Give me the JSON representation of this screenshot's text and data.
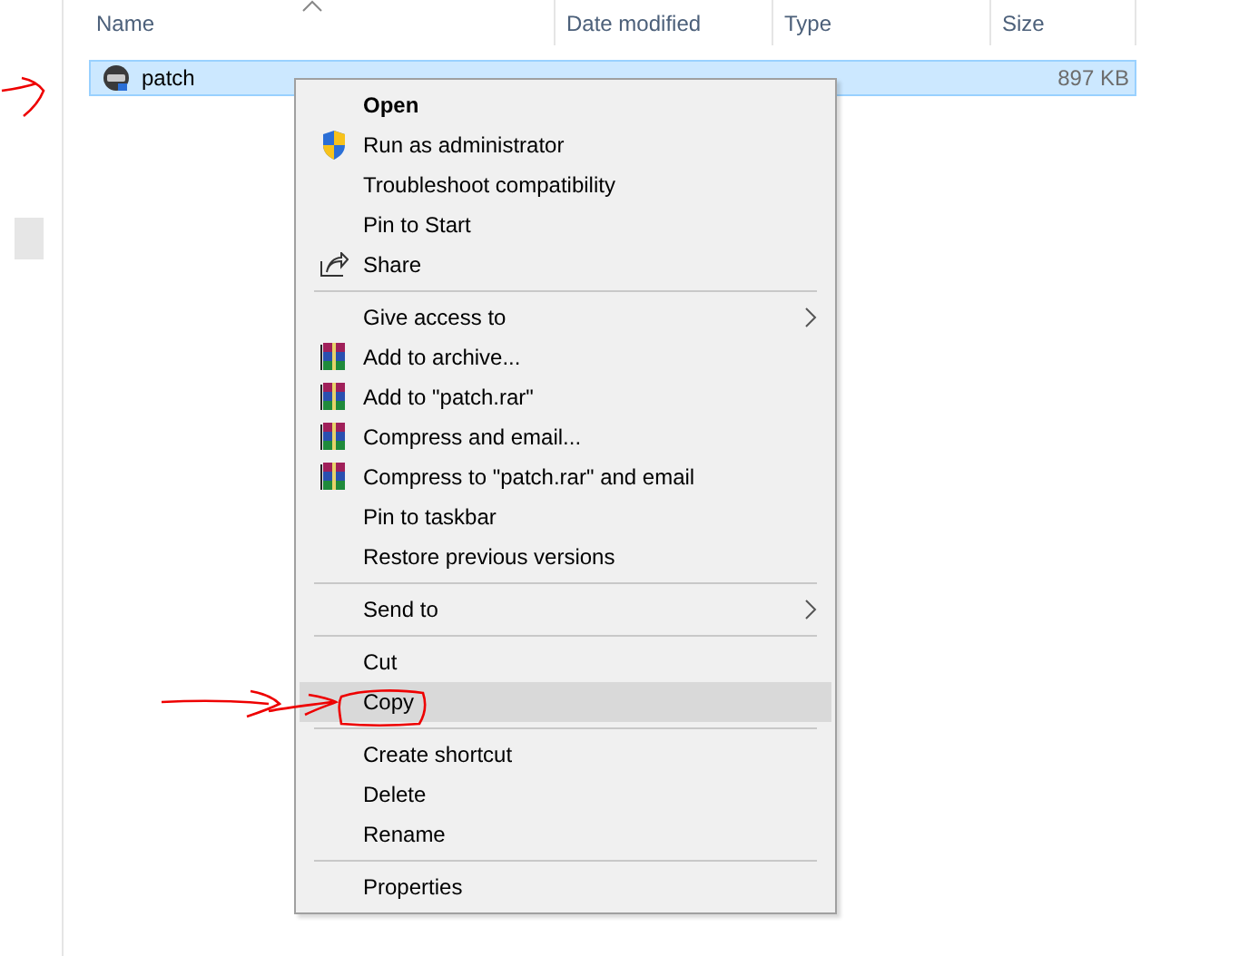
{
  "columns": [
    {
      "label": "Name",
      "sorted": true
    },
    {
      "label": "Date modified",
      "sorted": false
    },
    {
      "label": "Type",
      "sorted": false
    },
    {
      "label": "Size",
      "sorted": false
    }
  ],
  "file": {
    "name": "patch",
    "size": "897 KB",
    "selected": true
  },
  "context_menu": [
    {
      "kind": "plain",
      "label": "Open",
      "default": true,
      "selected": false
    },
    {
      "kind": "shield",
      "label": "Run as administrator",
      "selected": false
    },
    {
      "kind": "plain",
      "label": "Troubleshoot compatibility",
      "selected": false
    },
    {
      "kind": "plain",
      "label": "Pin to Start",
      "selected": false
    },
    {
      "kind": "share",
      "label": "Share",
      "selected": false
    },
    {
      "kind": "separator"
    },
    {
      "kind": "plain",
      "label": "Give access to",
      "submenu": true,
      "selected": false
    },
    {
      "kind": "archive",
      "label": "Add to archive...",
      "selected": false
    },
    {
      "kind": "archive",
      "label": "Add to \"patch.rar\"",
      "selected": false
    },
    {
      "kind": "archive",
      "label": "Compress and email...",
      "selected": false
    },
    {
      "kind": "archive",
      "label": "Compress to \"patch.rar\" and email",
      "selected": false
    },
    {
      "kind": "plain",
      "label": "Pin to taskbar",
      "selected": false
    },
    {
      "kind": "plain",
      "label": "Restore previous versions",
      "selected": false
    },
    {
      "kind": "separator"
    },
    {
      "kind": "plain",
      "label": "Send to",
      "submenu": true,
      "selected": false
    },
    {
      "kind": "separator"
    },
    {
      "kind": "plain",
      "label": "Cut",
      "selected": false
    },
    {
      "kind": "plain",
      "label": "Copy",
      "selected": true
    },
    {
      "kind": "separator"
    },
    {
      "kind": "plain",
      "label": "Create shortcut",
      "selected": false
    },
    {
      "kind": "plain",
      "label": "Delete",
      "selected": false
    },
    {
      "kind": "plain",
      "label": "Rename",
      "selected": false
    },
    {
      "kind": "separator"
    },
    {
      "kind": "plain",
      "label": "Properties",
      "selected": false
    }
  ]
}
